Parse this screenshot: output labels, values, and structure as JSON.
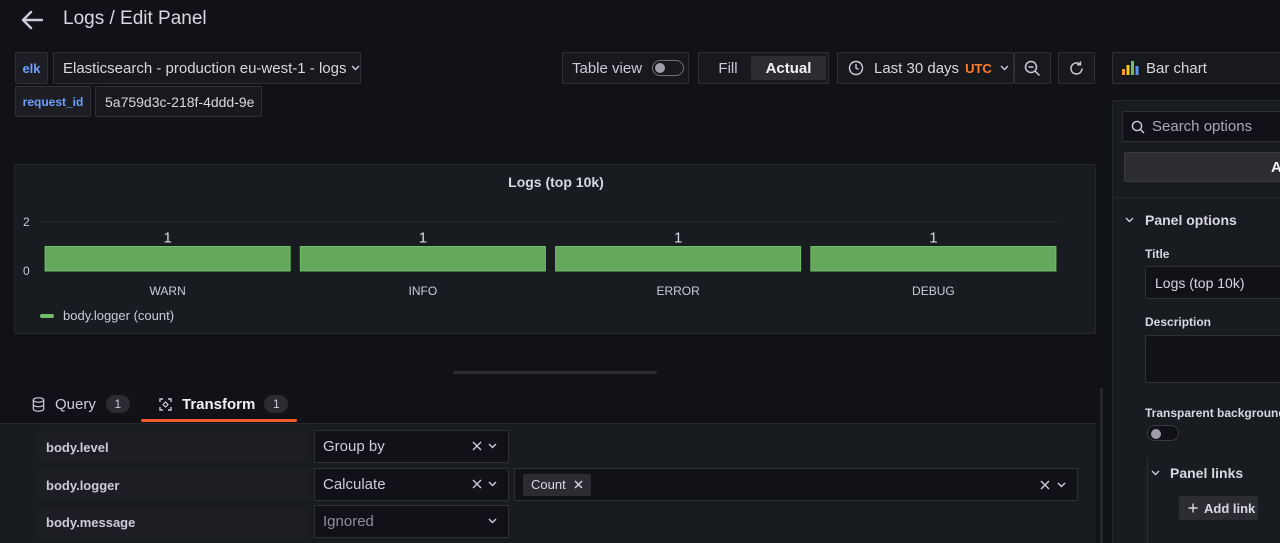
{
  "header": {
    "title": "Logs / Edit Panel"
  },
  "query_bar": {
    "datasource_tag": "elk",
    "datasource_name": "Elasticsearch - production eu-west-1 - logs",
    "filter_key": "request_id",
    "filter_value": "5a759d3c-218f-4ddd-9e"
  },
  "toolbar": {
    "table_view_label": "Table view",
    "table_view_on": false,
    "fill_label": "Fill",
    "actual_label": "Actual",
    "time_range": "Last 30 days",
    "timezone": "UTC",
    "viz_label": "Bar chart"
  },
  "colors": {
    "accent_green": "#73bf69",
    "utc_orange": "#ff7e2b",
    "blue_label": "#6e9fff",
    "tab_underline": "#f05a28"
  },
  "chart_data": {
    "type": "bar",
    "title": "Logs (top 10k)",
    "categories": [
      "WARN",
      "INFO",
      "ERROR",
      "DEBUG"
    ],
    "series": [
      {
        "name": "body.logger (count)",
        "values": [
          1,
          1,
          1,
          1
        ]
      }
    ],
    "yticks": [
      "2",
      "0"
    ],
    "ylim": [
      0,
      2
    ],
    "legend": "bottom-left"
  },
  "tabs": [
    {
      "label": "Query",
      "count": "1",
      "active": false
    },
    {
      "label": "Transform",
      "count": "1",
      "active": true
    }
  ],
  "transform": {
    "rows": [
      {
        "field": "body.level",
        "action": "Group by",
        "clearable": true
      },
      {
        "field": "body.logger",
        "action": "Calculate",
        "clearable": true,
        "calc_chip": "Count"
      },
      {
        "field": "body.message",
        "action": "Ignored",
        "clearable": false
      }
    ]
  },
  "options_pane": {
    "search_placeholder": "Search options",
    "tab_partial": "A",
    "section_title": "Panel options",
    "title_label": "Title",
    "title_value": "Logs (top 10k)",
    "description_label": "Description",
    "transparent_label": "Transparent background",
    "panel_links_label": "Panel links",
    "add_link_label": "Add link"
  }
}
